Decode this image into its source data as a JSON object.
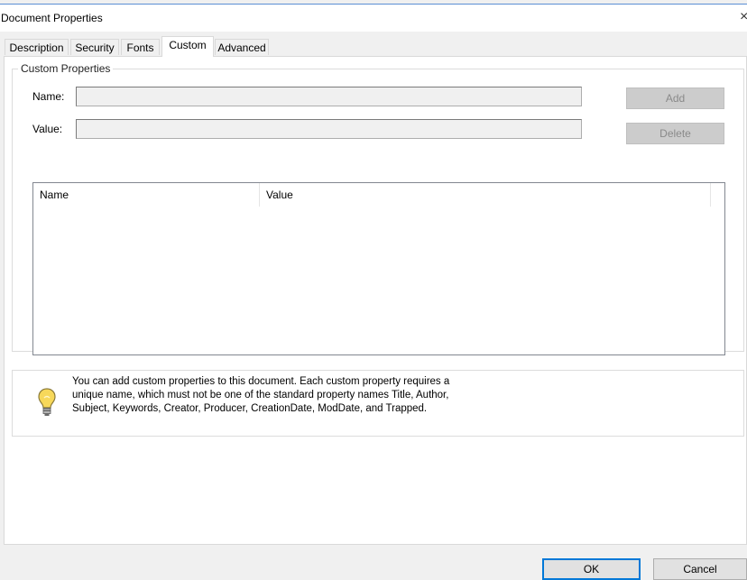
{
  "window": {
    "title": "Document Properties",
    "close_glyph": "×"
  },
  "tabs": [
    {
      "label": "Description",
      "active": false
    },
    {
      "label": "Security",
      "active": false
    },
    {
      "label": "Fonts",
      "active": false
    },
    {
      "label": "Custom",
      "active": true
    },
    {
      "label": "Advanced",
      "active": false
    }
  ],
  "custom": {
    "group_label": "Custom Properties",
    "name_label": "Name:",
    "value_label": "Value:",
    "name_value": "",
    "value_value": "",
    "add_label": "Add",
    "delete_label": "Delete",
    "list_columns": [
      "Name",
      "Value"
    ],
    "rows": []
  },
  "info": {
    "icon": "lightbulb-icon",
    "text": "You can add custom properties to this document. Each custom property requires a unique name, which must not be one of the standard property names Title, Author, Subject, Keywords, Creator, Producer, CreationDate, ModDate, and Trapped."
  },
  "footer": {
    "ok_label": "OK",
    "cancel_label": "Cancel"
  },
  "colors": {
    "focus": "#0078d7",
    "disabled_button": "#cccccc",
    "panel": "#ffffff",
    "chrome": "#f0f0f0"
  }
}
